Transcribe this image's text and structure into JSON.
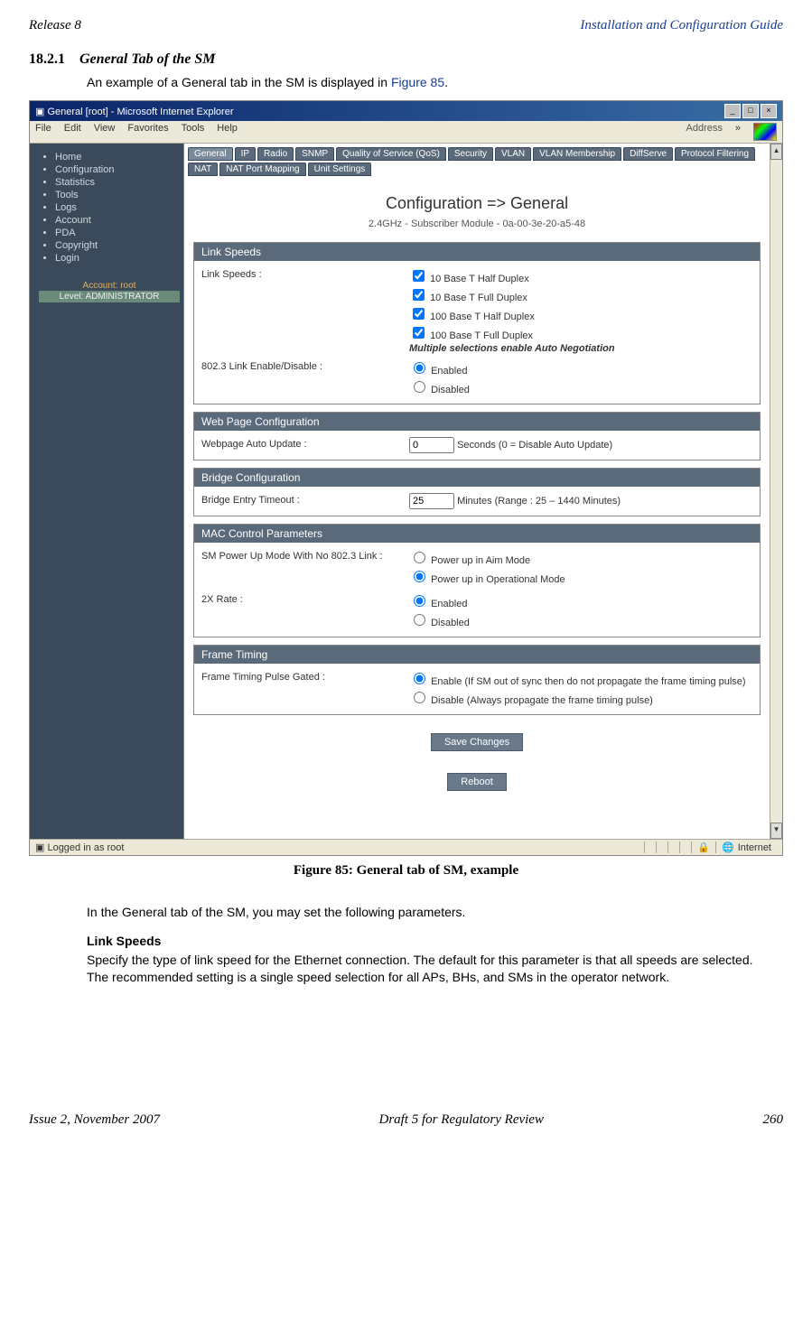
{
  "header": {
    "left": "Release 8",
    "right": "Installation and Configuration Guide"
  },
  "section": {
    "number": "18.2.1",
    "title": "General Tab of the SM",
    "intro_prefix": "An example of a General tab in the SM is displayed in ",
    "intro_link": "Figure 85",
    "intro_suffix": "."
  },
  "window": {
    "title": "General [root] - Microsoft Internet Explorer",
    "menus": [
      "File",
      "Edit",
      "View",
      "Favorites",
      "Tools",
      "Help"
    ],
    "address_label": "Address",
    "chevron": "»"
  },
  "sidebar": {
    "items": [
      "Home",
      "Configuration",
      "Statistics",
      "Tools",
      "Logs",
      "Account",
      "PDA",
      "Copyright",
      "Login"
    ],
    "account_label": "Account: root",
    "level_label": "Level: ADMINISTRATOR"
  },
  "tabs": {
    "row1": [
      "General",
      "IP",
      "Radio",
      "SNMP",
      "Quality of Service (QoS)",
      "Security",
      "VLAN",
      "VLAN Membership",
      "DiffServe",
      "Protocol Filtering",
      "NAT",
      "NAT Port Mapping",
      "Unit Settings"
    ]
  },
  "main": {
    "page_title": "Configuration => General",
    "subtitle": "2.4GHz - Subscriber Module - 0a-00-3e-20-a5-48",
    "sections": {
      "link_speeds": {
        "header": "Link Speeds",
        "label1": "Link Speeds :",
        "options": [
          "10 Base T Half Duplex",
          "10 Base T Full Duplex",
          "100 Base T Half Duplex",
          "100 Base T Full Duplex"
        ],
        "note": "Multiple selections enable Auto Negotiation",
        "label2": "802.3 Link Enable/Disable :",
        "radio": [
          "Enabled",
          "Disabled"
        ]
      },
      "webpage": {
        "header": "Web Page Configuration",
        "label": "Webpage Auto Update :",
        "value": "0",
        "suffix": "Seconds (0 = Disable Auto Update)"
      },
      "bridge": {
        "header": "Bridge Configuration",
        "label": "Bridge Entry Timeout :",
        "value": "25",
        "suffix": "Minutes (Range : 25 – 1440 Minutes)"
      },
      "mac": {
        "header": "MAC Control Parameters",
        "label1": "SM Power Up Mode With No 802.3 Link :",
        "radio1": [
          "Power up in Aim Mode",
          "Power up in Operational Mode"
        ],
        "label2": "2X Rate :",
        "radio2": [
          "Enabled",
          "Disabled"
        ]
      },
      "frame": {
        "header": "Frame Timing",
        "label": "Frame Timing Pulse Gated :",
        "radio": [
          "Enable (If SM out of sync then do not propagate the frame timing pulse)",
          "Disable (Always propagate the frame timing pulse)"
        ]
      }
    },
    "buttons": {
      "save": "Save Changes",
      "reboot": "Reboot"
    }
  },
  "statusbar": {
    "left": "Logged in as root",
    "right": "Internet"
  },
  "caption": "Figure 85: General tab of SM, example",
  "after": {
    "p1": "In the General tab of the SM, you may set the following parameters.",
    "h1": "Link Speeds",
    "p2": "Specify the type of link speed for the Ethernet connection. The default for this parameter is that all speeds are selected. The recommended setting is a single speed selection for all APs, BHs, and SMs in the operator network."
  },
  "footer": {
    "left": "Issue 2, November 2007",
    "center": "Draft 5 for Regulatory Review",
    "right": "260"
  }
}
